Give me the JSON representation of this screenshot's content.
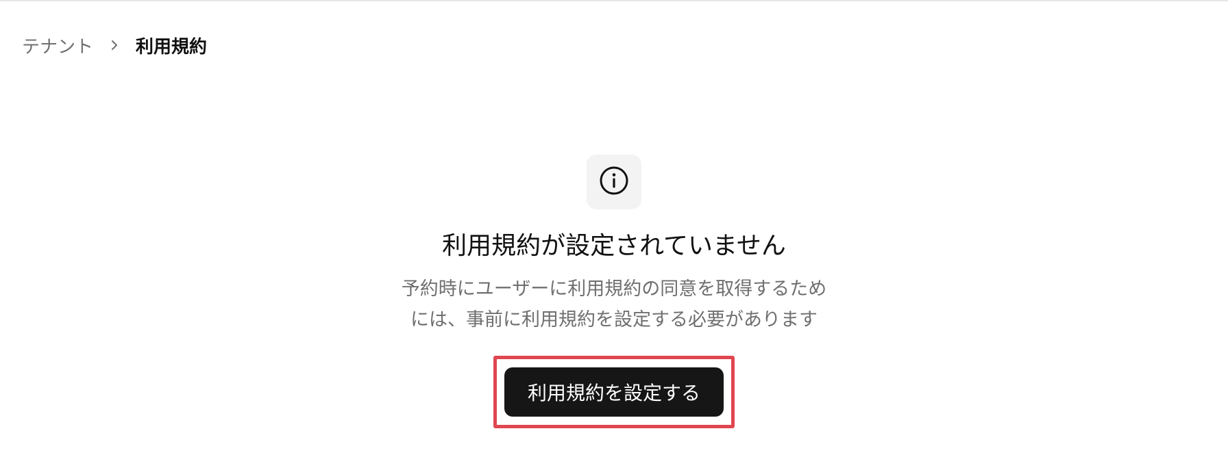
{
  "breadcrumb": {
    "parent": "テナント",
    "current": "利用規約"
  },
  "empty_state": {
    "icon": "info-icon",
    "title": "利用規約が設定されていません",
    "description_lines": [
      "予約時にユーザーに利用規約の同意を取得するため",
      "には、事前に利用規約を設定する必要があります"
    ],
    "action_label": "利用規約を設定する"
  },
  "colors": {
    "button_bg": "#161616",
    "highlight_border": "#e0464f",
    "muted_text": "#6f6f6f",
    "icon_bg": "#f3f3f3"
  }
}
